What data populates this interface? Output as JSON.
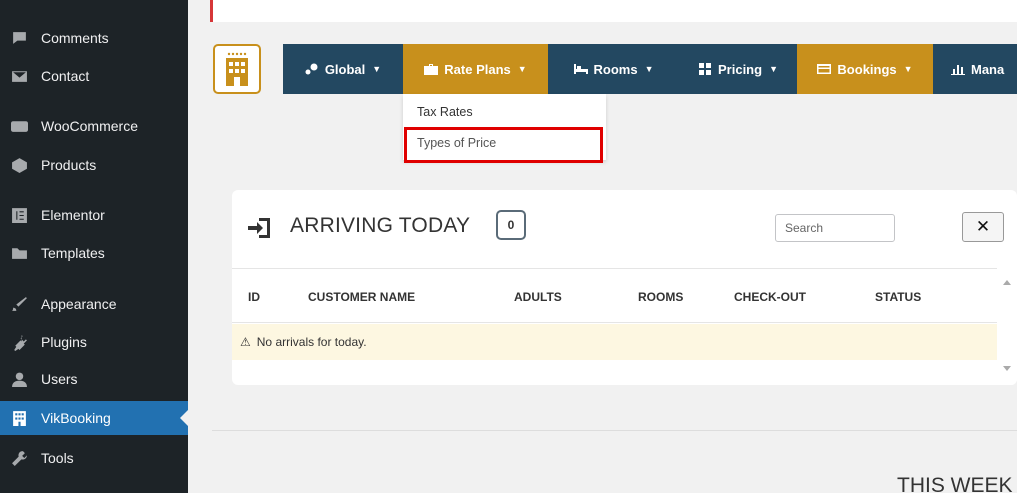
{
  "sidebar": {
    "items": [
      {
        "label": "Comments",
        "icon": "comments-icon"
      },
      {
        "label": "Contact",
        "icon": "mail-icon"
      },
      {
        "label": "WooCommerce",
        "icon": "woocommerce-icon"
      },
      {
        "label": "Products",
        "icon": "products-icon"
      },
      {
        "label": "Elementor",
        "icon": "elementor-icon"
      },
      {
        "label": "Templates",
        "icon": "folder-icon"
      },
      {
        "label": "Appearance",
        "icon": "appearance-icon"
      },
      {
        "label": "Plugins",
        "icon": "plugins-icon"
      },
      {
        "label": "Users",
        "icon": "users-icon"
      },
      {
        "label": "VikBooking",
        "icon": "building-icon",
        "active": true
      },
      {
        "label": "Tools",
        "icon": "wrench-icon"
      }
    ],
    "colors": {
      "bg": "#1d2327",
      "active": "#2271b1"
    }
  },
  "menubar": {
    "items": [
      {
        "label": "Global",
        "icon": "globe-icon",
        "highlight": false
      },
      {
        "label": "Rate Plans",
        "icon": "briefcase-icon",
        "highlight": true
      },
      {
        "label": "Rooms",
        "icon": "bed-icon",
        "highlight": false
      },
      {
        "label": "Pricing",
        "icon": "calculator-icon",
        "highlight": false
      },
      {
        "label": "Bookings",
        "icon": "card-icon",
        "highlight": true
      },
      {
        "label": "Mana",
        "icon": "chart-icon",
        "highlight": false
      }
    ],
    "colors": {
      "bar": "#234861",
      "gold": "#c8901c"
    }
  },
  "dropdown": {
    "items": [
      "Tax Rates",
      "Types of Price"
    ],
    "highlighted": "Types of Price"
  },
  "arriving": {
    "title": "ARRIVING TODAY",
    "count": "0",
    "search_placeholder": "Search",
    "clear_label": "✕",
    "columns": [
      "ID",
      "CUSTOMER NAME",
      "ADULTS",
      "ROOMS",
      "CHECK-OUT",
      "STATUS"
    ],
    "empty_message": "No arrivals for today."
  },
  "week_title": "THIS WEEK"
}
